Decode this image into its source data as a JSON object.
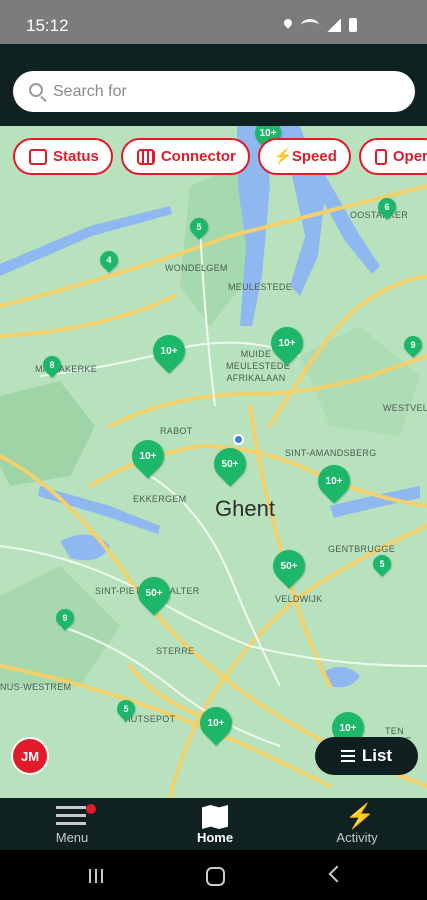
{
  "status_bar": {
    "time": "15:12"
  },
  "search": {
    "placeholder": "Search for"
  },
  "filters": [
    {
      "label": "Status",
      "icon": "status-icon"
    },
    {
      "label": "Connector",
      "icon": "connector-icon"
    },
    {
      "label": "Speed",
      "icon": "lightning-icon"
    },
    {
      "label": "Oper",
      "icon": "operator-icon"
    }
  ],
  "map": {
    "city_label": "Ghent",
    "place_labels": [
      "WONDELGEM",
      "MEULESTEDE",
      "MUIDE MEULESTEDE AFRIKALAAN",
      "RABOT",
      "SINT-AMANDSBERG",
      "EKKERGEM",
      "GENTBRUGGE",
      "SINT-PIETERS-AALTER",
      "STERRE",
      "VELDWIJK",
      "WESTVELD",
      "OOSTAKKER",
      "HUTSEPOT",
      "TEN HOVE",
      "NUS-WESTREM",
      "MARIAKERKE"
    ],
    "pins": [
      {
        "label": "10+"
      },
      {
        "label": "5"
      },
      {
        "label": "4"
      },
      {
        "label": "6"
      },
      {
        "label": "10+"
      },
      {
        "label": "10+"
      },
      {
        "label": "8"
      },
      {
        "label": "9"
      },
      {
        "label": "10+"
      },
      {
        "label": "50+"
      },
      {
        "label": "10+"
      },
      {
        "label": "50+"
      },
      {
        "label": "5"
      },
      {
        "label": "50+"
      },
      {
        "label": "9"
      },
      {
        "label": "5"
      },
      {
        "label": "10+"
      },
      {
        "label": "10+"
      }
    ],
    "colors": {
      "pin": "#1db76a",
      "land": "#b7e2bd",
      "water": "#8fb8f0",
      "road": "#f2d06b"
    }
  },
  "avatar": {
    "initials": "JM"
  },
  "list_button": {
    "label": "List"
  },
  "bottom_nav": {
    "menu": "Menu",
    "home": "Home",
    "activity": "Activity"
  },
  "accent_color": "#e21b2a"
}
